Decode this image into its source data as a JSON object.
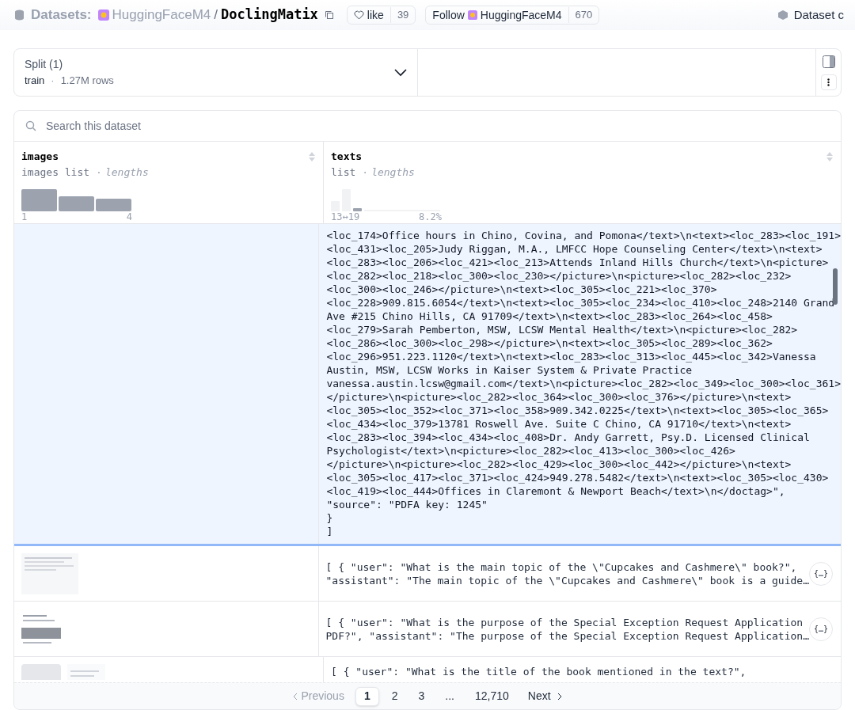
{
  "header": {
    "section": "Datasets:",
    "org": "HuggingFaceM4",
    "separator": "/",
    "name": "DoclingMatix",
    "like": {
      "label": "like",
      "count": "39"
    },
    "follow": {
      "label": "Follow",
      "org": "HuggingFaceM4",
      "count": "670"
    },
    "card_link": "Dataset c"
  },
  "split": {
    "label": "Split (1)",
    "value": "train",
    "separator": "·",
    "rows": "1.27M rows"
  },
  "search": {
    "placeholder": "Search this dataset"
  },
  "columns": [
    {
      "name": "images",
      "type": "images list",
      "separator": "·",
      "stat": "lengths",
      "axis_labels": [
        "1",
        "4"
      ]
    },
    {
      "name": "texts",
      "type": "list",
      "separator": "·",
      "stat": "lengths",
      "axis_labels": [
        "13↔19",
        "8.2%"
      ]
    }
  ],
  "expanded_row": {
    "lines": [
      "<loc_174>Office hours in Chino, Covina, and Pomona</text>\\n<text><loc_283><loc_191>",
      "<loc_431><loc_205>Judy Riggan, M.A., LMFCC Hope Counseling Center</text>\\n<text>",
      "<loc_283><loc_206><loc_421><loc_213>Attends Inland Hills Church</text>\\n<picture>",
      "<loc_282><loc_218><loc_300><loc_230></picture>\\n<picture><loc_282><loc_232>",
      "<loc_300><loc_246></picture>\\n<text><loc_305><loc_221><loc_370>",
      "<loc_228>909.815.6054</text>\\n<text><loc_305><loc_234><loc_410><loc_248>2140 Grand",
      "Ave #215 Chino Hills, CA 91709</text>\\n<text><loc_283><loc_264><loc_458>",
      "<loc_279>Sarah Pemberton, MSW, LCSW Mental Health</text>\\n<picture><loc_282>",
      "<loc_286><loc_300><loc_298></picture>\\n<text><loc_305><loc_289><loc_362>",
      "<loc_296>951.223.1120</text>\\n<text><loc_283><loc_313><loc_445><loc_342>Vanessa",
      "Austin, MSW, LCSW Works in Kaiser System & Private Practice",
      "vanessa.austin.lcsw@gmail.com</text>\\n<picture><loc_282><loc_349><loc_300><loc_361>",
      "</picture>\\n<picture><loc_282><loc_364><loc_300><loc_376></picture>\\n<text>",
      "<loc_305><loc_352><loc_371><loc_358>909.342.0225</text>\\n<text><loc_305><loc_365>",
      "<loc_434><loc_379>13781 Roswell Ave. Suite C Chino, CA 91710</text>\\n<text>",
      "<loc_283><loc_394><loc_434><loc_408>Dr. Andy Garrett, Psy.D. Licensed Clinical",
      "Psychologist</text>\\n<picture><loc_282><loc_413><loc_300><loc_426>",
      "</picture>\\n<picture><loc_282><loc_429><loc_300><loc_442></picture>\\n<text>",
      "<loc_305><loc_417><loc_371><loc_424>949.278.5482</text>\\n<text><loc_305><loc_430>",
      "<loc_419><loc_444>Offices in Claremont & Newport Beach</text>\\n</doctag>\",",
      "\"source\": \"PDFA key: 1245\"",
      "}",
      "]"
    ]
  },
  "rows": [
    {
      "lines": [
        "[ { \"user\": \"What is the main topic of the \\\"Cupcakes and Cashmere\\\" book?\",",
        "\"assistant\": \"The main topic of the \\\"Cupcakes and Cashmere\\\" book is a guide…"
      ],
      "button": "{…}"
    },
    {
      "lines": [
        "[ { \"user\": \"What is the purpose of the Special Exception Request Application",
        "PDF?\", \"assistant\": \"The purpose of the Special Exception Request Application…"
      ],
      "button": "{…}"
    },
    {
      "lines": [
        "[ { \"user\": \"What is the title of the book mentioned in the text?\","
      ]
    }
  ],
  "pagination": {
    "previous": {
      "label": "Previous",
      "disabled": true
    },
    "pages": [
      {
        "label": "1",
        "selected": true
      },
      {
        "label": "2",
        "selected": false
      },
      {
        "label": "3",
        "selected": false
      },
      {
        "label": "...",
        "selected": false
      },
      {
        "label": "12,710",
        "selected": false
      }
    ],
    "next": {
      "label": "Next",
      "disabled": false
    }
  }
}
